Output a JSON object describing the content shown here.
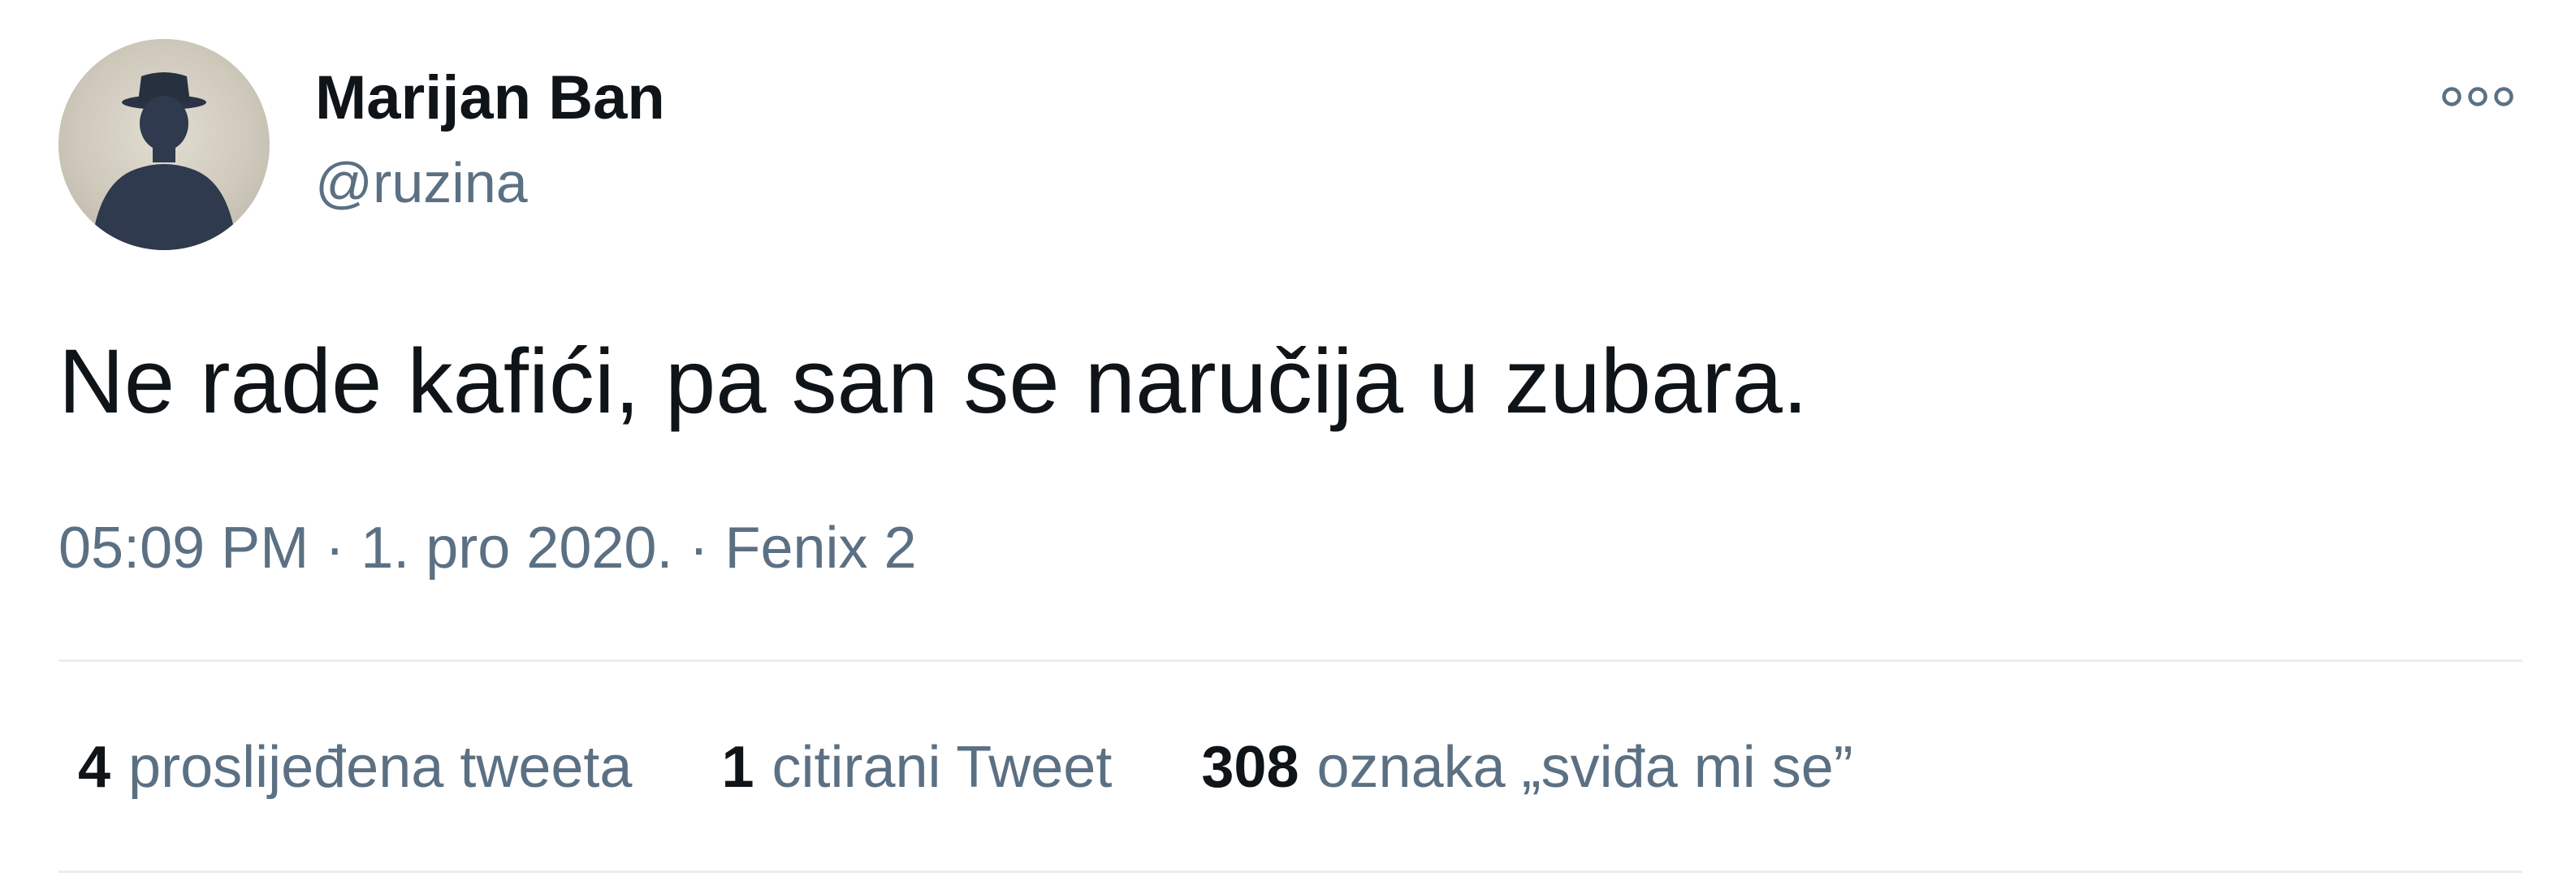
{
  "author": {
    "display_name": "Marijan Ban",
    "handle": "@ruzina",
    "avatar_icon": "silhouette-hat-avatar"
  },
  "more_icon": "more-options-icon",
  "tweet": {
    "text": "Ne rade kafići, pa san se naručija u zubara."
  },
  "meta": {
    "time": "05:09 PM",
    "separator": "·",
    "date": "1. pro 2020.",
    "source": "Fenix 2"
  },
  "stats": [
    {
      "count": "4",
      "label": "proslijeđena tweeta"
    },
    {
      "count": "1",
      "label": "citirani Tweet"
    },
    {
      "count": "308",
      "label": "oznaka „sviđa mi se”"
    }
  ],
  "colors": {
    "text_primary": "#0f1419",
    "text_secondary": "#5b7083",
    "divider": "#ebeef0",
    "background": "#ffffff"
  }
}
